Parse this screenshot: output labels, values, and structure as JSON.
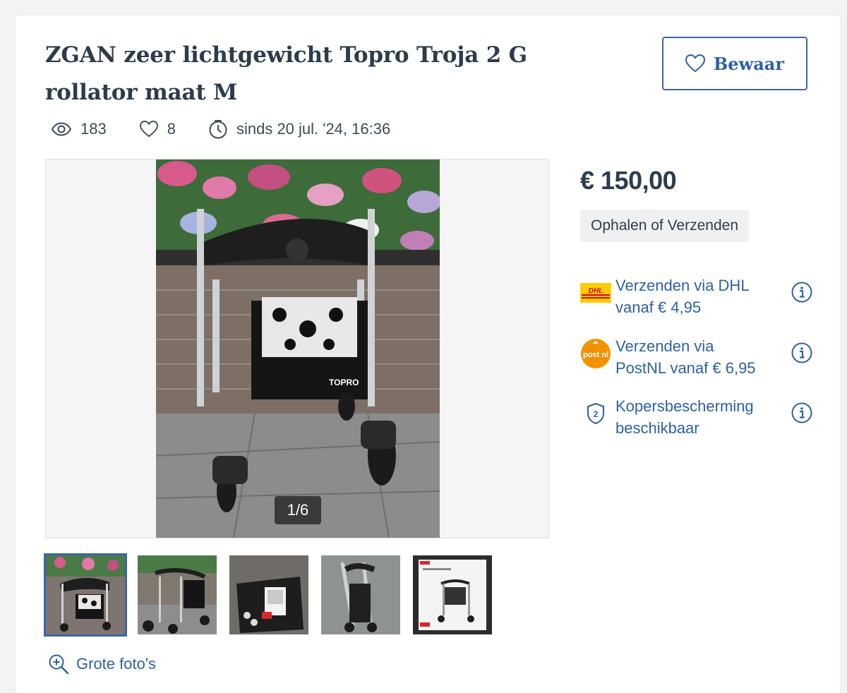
{
  "listing": {
    "title": "ZGAN zeer lichtgewicht Topro Troja 2 G rollator maat M",
    "save_label": "Bewaar",
    "views": "183",
    "favorites": "8",
    "since": "sinds 20 jul. '24, 16:36"
  },
  "gallery": {
    "counter": "1/6",
    "thumbnail_count": 5,
    "large_photos_label": "Grote foto's"
  },
  "photo_brand_text": "TOPRO",
  "sidebar": {
    "price": "€ 150,00",
    "delivery_badge": "Ophalen of Verzenden",
    "shipping": [
      {
        "logo": "dhl-logo",
        "line1": "Verzenden via DHL",
        "line2": "vanaf € 4,95",
        "logo_text": "DHL"
      },
      {
        "logo": "postnl-logo",
        "line1": "Verzenden via",
        "line2": "PostNL vanaf € 6,95",
        "logo_text": "post nl"
      },
      {
        "logo": "buyer-protection-shield-icon",
        "line1": "Kopersbescherming",
        "line2": "beschikbaar"
      }
    ]
  },
  "colors": {
    "accent_blue": "#2d61a6",
    "text": "#2d3c4d",
    "dhl_yellow": "#ffcc00",
    "dhl_red": "#d40511",
    "postnl_orange": "#f39200"
  }
}
